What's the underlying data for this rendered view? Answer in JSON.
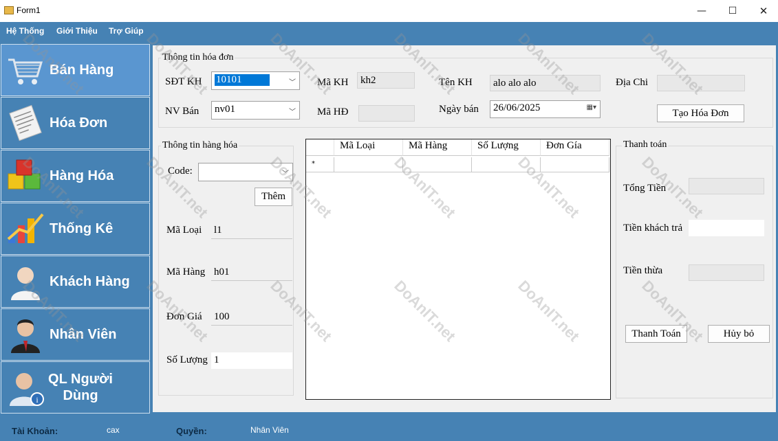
{
  "window": {
    "title": "Form1"
  },
  "menu": [
    "Hệ Thống",
    "Giới Thiệu",
    "Trợ Giúp"
  ],
  "sidebar": [
    {
      "label": "Bán Hàng",
      "icon": "shopping-cart-icon",
      "active": true
    },
    {
      "label": "Hóa Đơn",
      "icon": "invoice-icon"
    },
    {
      "label": "Hàng Hóa",
      "icon": "boxes-icon"
    },
    {
      "label": "Thống Kê",
      "icon": "chart-icon"
    },
    {
      "label": "Khách Hàng",
      "icon": "customer-icon"
    },
    {
      "label": "Nhân Viên",
      "icon": "employee-icon"
    },
    {
      "label": "QL Người Dùng",
      "icon": "user-admin-icon"
    }
  ],
  "invoice_info": {
    "title": "Thông tin hóa đơn",
    "sdt_label": "SĐT KH",
    "sdt_value": "10101",
    "makh_label": "Mã KH",
    "makh_value": "kh2",
    "tenkh_label": "Tên KH",
    "tenkh_value": "alo alo alo",
    "diachi_label": "Địa Chi",
    "diachi_value": "",
    "nvban_label": "NV Bán",
    "nvban_value": "nv01",
    "mahd_label": "Mã HĐ",
    "mahd_value": "",
    "ngayban_label": "Ngày bán",
    "ngayban_value": "26/06/2025",
    "create_button": "Tạo Hóa Đơn"
  },
  "goods_info": {
    "title": "Thông tin hàng hóa",
    "code_label": "Code:",
    "code_value": "",
    "add_button": "Thêm",
    "maloai_label": "Mã Loại",
    "maloai_value": "l1",
    "mahang_label": "Mã Hàng",
    "mahang_value": "h01",
    "dongia_label": "Đơn Giá",
    "dongia_value": "100",
    "soluong_label": "Số Lượng",
    "soluong_value": "1"
  },
  "grid": {
    "columns": [
      "Mã Loại",
      "Mã Hàng",
      "Số Lượng",
      "Đơn Gía"
    ],
    "new_row_marker": "*"
  },
  "payment": {
    "title": "Thanh toán",
    "total_label": "Tổng Tiền",
    "total_value": "",
    "paid_label": "Tiền khách trả",
    "paid_value": "",
    "change_label": "Tiền thừa",
    "change_value": "",
    "pay_button": "Thanh Toán",
    "cancel_button": "Hủy bỏ"
  },
  "footer": {
    "account_label": "Tài Khoản:",
    "account_value": "cax",
    "role_label": "Quyền:",
    "role_value": "Nhân Viên"
  },
  "watermark": "DoAnIT.net"
}
